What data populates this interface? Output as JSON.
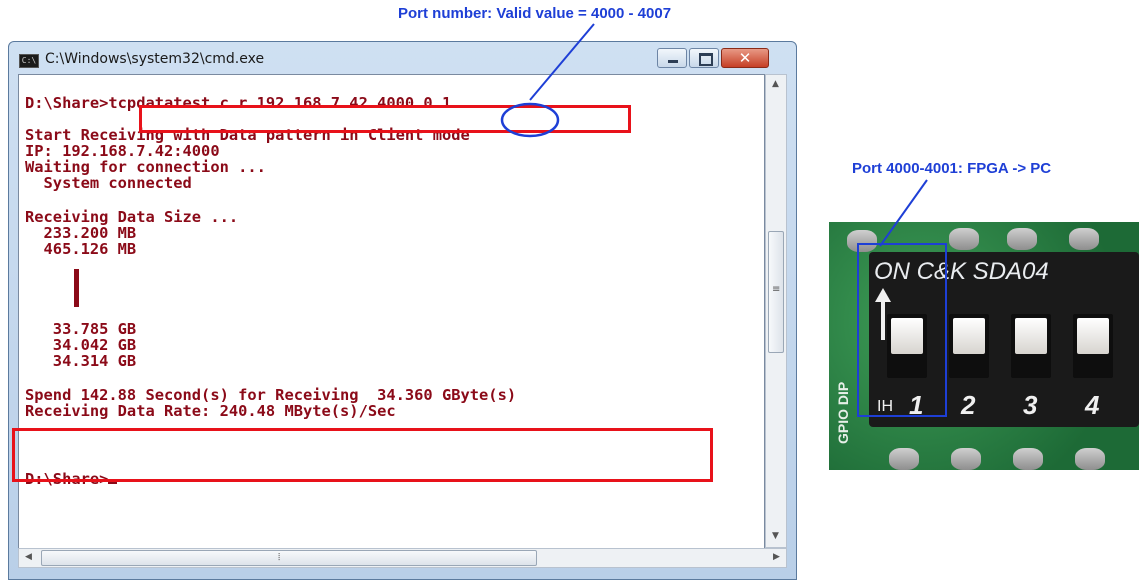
{
  "annotations": {
    "port_number": "Port number: Valid value = 4000 - 4007",
    "port_direction": "Port 4000-4001: FPGA -> PC"
  },
  "window": {
    "title": "C:\\Windows\\system32\\cmd.exe",
    "icon_text": "C:\\",
    "close_glyph": "✕"
  },
  "console": {
    "lines": [
      "D:\\Share>tcpdatatest c r 192.168.7.42 4000 0 1",
      "Start Receiving with Data pattern in Client mode",
      "IP: 192.168.7.42:4000",
      "Waiting for connection ...",
      "  System connected",
      "Receiving Data Size ...",
      "  233.200 MB",
      "  465.126 MB",
      "   33.785 GB",
      "   34.042 GB",
      "   34.314 GB",
      "Spend 142.88 Second(s) for Receiving  34.360 GByte(s)",
      "Receiving Data Rate: 240.48 MByte(s)/Sec",
      "D:\\Share>"
    ]
  },
  "photo": {
    "switch_label": "ON C&K SDA04",
    "positions": [
      "1",
      "2",
      "3",
      "4"
    ],
    "ih_label": "IH",
    "pcb_label": "GPIO DIP"
  },
  "colors": {
    "annotation_blue": "#1e3fd6",
    "highlight_red": "#e8121a",
    "console_text": "#8b0a18"
  }
}
